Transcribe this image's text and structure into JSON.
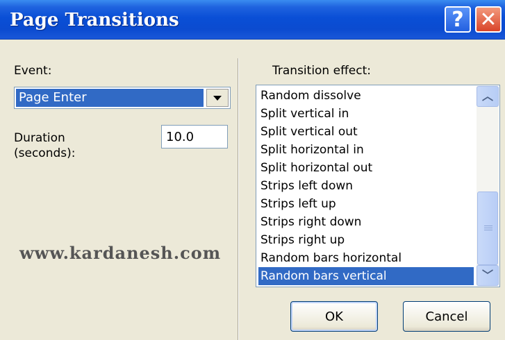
{
  "window": {
    "title": "Page Transitions",
    "help_label": "?",
    "close_label": "✕"
  },
  "event": {
    "label": "Event:",
    "selected": "Page Enter"
  },
  "duration": {
    "label": "Duration\n(seconds):",
    "value": "10.0"
  },
  "watermark": "www.kardanesh.com",
  "transition": {
    "label": "Transition effect:",
    "items": [
      "Random dissolve",
      "Split vertical in",
      "Split vertical out",
      "Split horizontal in",
      "Split horizontal out",
      "Strips left down",
      "Strips left up",
      "Strips right down",
      "Strips right up",
      "Random bars horizontal",
      "Random bars vertical"
    ],
    "selected": "Random bars vertical"
  },
  "buttons": {
    "ok": "OK",
    "cancel": "Cancel"
  },
  "colors": {
    "titlebar": "#0b4bd0",
    "selection": "#316ac5",
    "dialog_bg": "#ece9d8"
  }
}
